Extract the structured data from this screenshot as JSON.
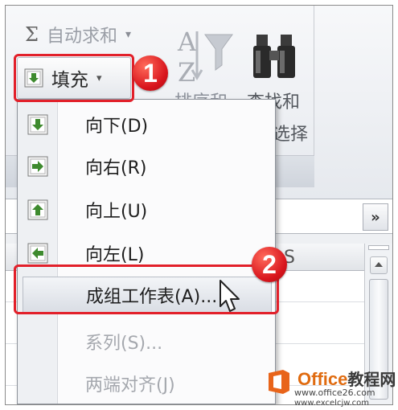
{
  "ribbon": {
    "autosum_symbol": "Σ",
    "autosum_label": "自动求和",
    "fill_label": "填充",
    "sort_label": "排序和",
    "find_label_line1": "查找和",
    "find_label_line2": "选择",
    "dropdown_arrow": "▾"
  },
  "badges": {
    "step1": "1",
    "step2": "2"
  },
  "sheet": {
    "column_label": "S",
    "expand_glyph": "»"
  },
  "fill_menu": {
    "items": [
      {
        "label": "向下(D)",
        "enabled": true
      },
      {
        "label": "向右(R)",
        "enabled": true
      },
      {
        "label": "向上(U)",
        "enabled": true
      },
      {
        "label": "向左(L)",
        "enabled": true
      },
      {
        "label": "成组工作表(A)...",
        "enabled": true,
        "highlighted": true
      },
      {
        "label": "系列(S)...",
        "enabled": false
      },
      {
        "label": "两端对齐(J)",
        "enabled": false
      }
    ]
  },
  "watermark": {
    "brand": "Office",
    "brand_cn": "教程网",
    "url1": "www.office26.com",
    "url2": "www.excelcjw.com"
  },
  "colors": {
    "highlight_red": "#e2202a",
    "badge_red": "#d8141c",
    "arrow_green": "#3e8a2e",
    "watermark_orange": "#e06b10"
  }
}
